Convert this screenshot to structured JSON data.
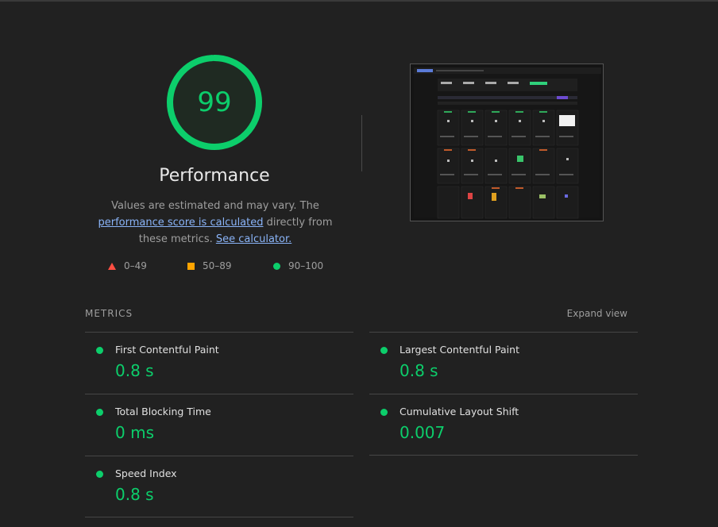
{
  "score": {
    "value": "99",
    "fraction": 0.99,
    "color": "#0cce6b"
  },
  "performance": {
    "title": "Performance",
    "description_prefix": "Values are estimated and may vary. The ",
    "link1": "performance score is calculated",
    "description_middle": " directly from these metrics. ",
    "link2": "See calculator."
  },
  "legend": {
    "fail": "0–49",
    "average": "50–89",
    "pass": "90–100",
    "fail_color": "#ff4e42",
    "average_color": "#ffa400",
    "pass_color": "#0cce6b"
  },
  "metrics": {
    "header": "METRICS",
    "expand": "Expand view",
    "items": [
      {
        "label": "First Contentful Paint",
        "value": "0.8 s"
      },
      {
        "label": "Largest Contentful Paint",
        "value": "0.8 s"
      },
      {
        "label": "Total Blocking Time",
        "value": "0 ms"
      },
      {
        "label": "Cumulative Layout Shift",
        "value": "0.007"
      },
      {
        "label": "Speed Index",
        "value": "0.8 s"
      }
    ]
  },
  "thumbnail": {
    "icon": "page-screenshot-thumbnail"
  }
}
